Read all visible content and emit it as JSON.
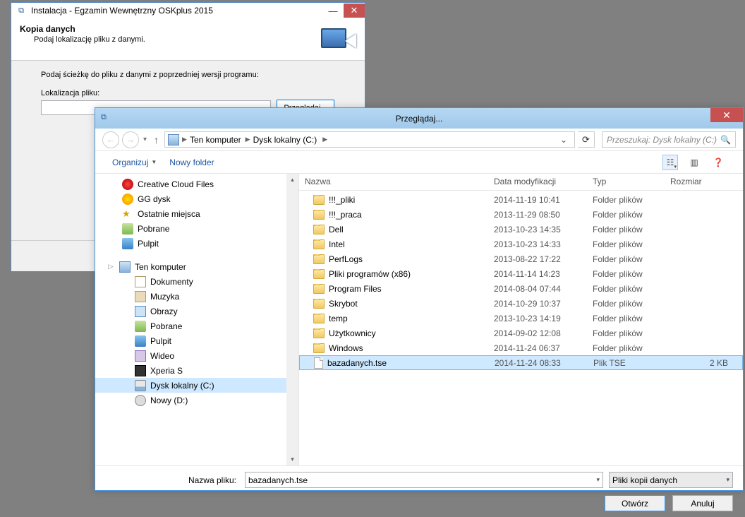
{
  "installer": {
    "title": "Instalacja - Egzamin Wewnętrzny OSKplus 2015",
    "head_title": "Kopia danych",
    "head_sub": "Podaj lokalizację pliku z danymi.",
    "prompt": "Podaj ścieżkę do pliku z danymi z poprzedniej wersji programu:",
    "loc_label": "Lokalizacja pliku:",
    "browse": "Przeglądaj..."
  },
  "browse": {
    "title": "Przeglądaj...",
    "crumbs": [
      "Ten komputer",
      "Dysk lokalny (C:)"
    ],
    "search_placeholder": "Przeszukaj: Dysk lokalny (C:)",
    "toolbar": {
      "organize": "Organizuj",
      "newfolder": "Nowy folder"
    },
    "columns": {
      "name": "Nazwa",
      "date": "Data modyfikacji",
      "type": "Typ",
      "size": "Rozmiar"
    },
    "tree": {
      "cc": "Creative Cloud Files",
      "gg": "GG dysk",
      "recent": "Ostatnie miejsca",
      "dl": "Pobrane",
      "desk": "Pulpit",
      "pc": "Ten komputer",
      "docs": "Dokumenty",
      "music": "Muzyka",
      "pics": "Obrazy",
      "dl2": "Pobrane",
      "desk2": "Pulpit",
      "video": "Wideo",
      "xperia": "Xperia S",
      "cdrive": "Dysk lokalny (C:)",
      "ddrive": "Nowy (D:)"
    },
    "files": [
      {
        "name": "!!!_pliki",
        "date": "2014-11-19 10:41",
        "type": "Folder plików",
        "size": "",
        "kind": "folder"
      },
      {
        "name": "!!!_praca",
        "date": "2013-11-29 08:50",
        "type": "Folder plików",
        "size": "",
        "kind": "folder"
      },
      {
        "name": "Dell",
        "date": "2013-10-23 14:35",
        "type": "Folder plików",
        "size": "",
        "kind": "folder"
      },
      {
        "name": "Intel",
        "date": "2013-10-23 14:33",
        "type": "Folder plików",
        "size": "",
        "kind": "folder"
      },
      {
        "name": "PerfLogs",
        "date": "2013-08-22 17:22",
        "type": "Folder plików",
        "size": "",
        "kind": "folder"
      },
      {
        "name": "Pliki programów (x86)",
        "date": "2014-11-14 14:23",
        "type": "Folder plików",
        "size": "",
        "kind": "folder"
      },
      {
        "name": "Program Files",
        "date": "2014-08-04 07:44",
        "type": "Folder plików",
        "size": "",
        "kind": "folder"
      },
      {
        "name": "Skrybot",
        "date": "2014-10-29 10:37",
        "type": "Folder plików",
        "size": "",
        "kind": "folder"
      },
      {
        "name": "temp",
        "date": "2013-10-23 14:19",
        "type": "Folder plików",
        "size": "",
        "kind": "folder"
      },
      {
        "name": "Użytkownicy",
        "date": "2014-09-02 12:08",
        "type": "Folder plików",
        "size": "",
        "kind": "folder"
      },
      {
        "name": "Windows",
        "date": "2014-11-24 06:37",
        "type": "Folder plików",
        "size": "",
        "kind": "folder"
      },
      {
        "name": "bazadanych.tse",
        "date": "2014-11-24 08:33",
        "type": "Plik TSE",
        "size": "2 KB",
        "kind": "file",
        "selected": true
      }
    ],
    "filename_label": "Nazwa pliku:",
    "filename_value": "bazadanych.tse",
    "filter": "Pliki kopii danych",
    "open": "Otwórz",
    "cancel": "Anuluj"
  }
}
